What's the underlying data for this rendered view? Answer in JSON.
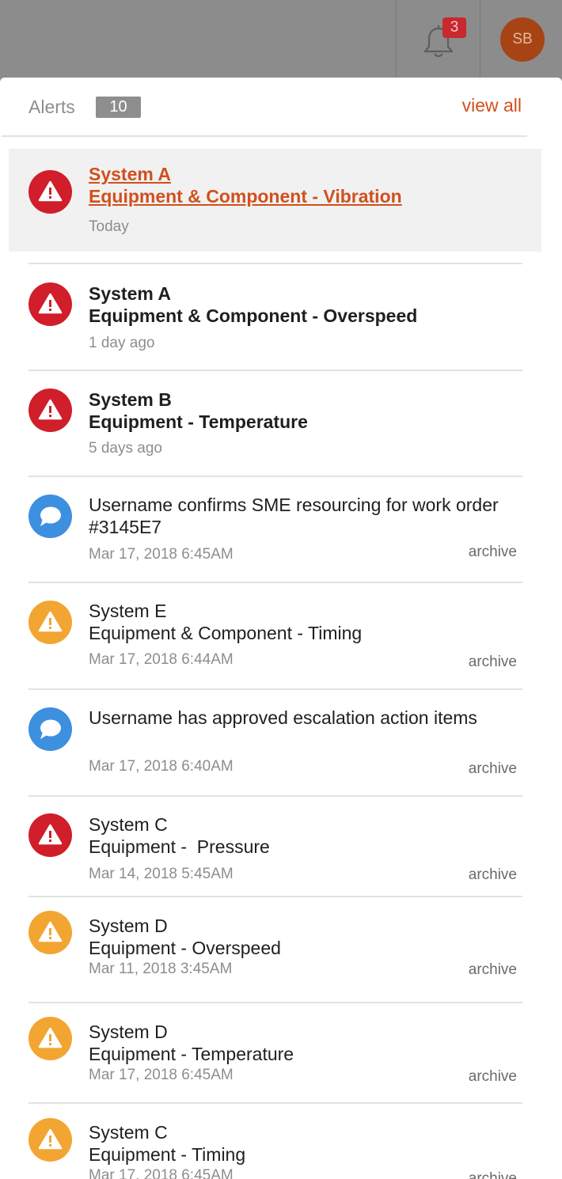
{
  "topbar": {
    "notification_count": "3",
    "avatar_initials": "SB",
    "bell_icon": "bell-icon"
  },
  "panel": {
    "title": "Alerts",
    "count": "10",
    "view_all": "view all",
    "colors": {
      "critical": "#d01e2b",
      "warning": "#f3a532",
      "message": "#3d8fe0",
      "accent": "#d1501c"
    },
    "items": [
      {
        "kind": "critical",
        "icon": "warning-triangle-icon",
        "title": "System A",
        "subtitle": "Equipment & Component - Vibration",
        "time": "Today"
      },
      {
        "kind": "critical",
        "icon": "warning-triangle-icon",
        "title": "System A",
        "subtitle": "Equipment & Component - Overspeed",
        "time": "1 day ago"
      },
      {
        "kind": "critical",
        "icon": "warning-triangle-icon",
        "title": "System B",
        "subtitle": "Equipment - Temperature",
        "time": "5 days ago"
      },
      {
        "kind": "message",
        "icon": "chat-bubble-icon",
        "message": "Username confirms SME resourcing for work order #3145E7",
        "time": "Mar 17, 2018 6:45AM",
        "archive": "archive"
      },
      {
        "kind": "warning",
        "icon": "warning-triangle-icon",
        "title": "System E",
        "subtitle": "Equipment & Component - Timing",
        "time": "Mar 17, 2018 6:44AM",
        "archive": "archive"
      },
      {
        "kind": "message",
        "icon": "chat-bubble-icon",
        "message": "Username has approved escalation action items",
        "time": "Mar 17, 2018 6:40AM",
        "archive": "archive"
      },
      {
        "kind": "critical",
        "icon": "warning-triangle-icon",
        "title": "System C",
        "subtitle": "Equipment -  Pressure",
        "time": "Mar 14, 2018 5:45AM",
        "archive": "archive"
      },
      {
        "kind": "warning",
        "icon": "warning-triangle-icon",
        "title": "System D",
        "subtitle": "Equipment - Overspeed",
        "time": "Mar 11, 2018 3:45AM",
        "archive": "archive"
      },
      {
        "kind": "warning",
        "icon": "warning-triangle-icon",
        "title": "System D",
        "subtitle": "Equipment - Temperature",
        "time": "Mar 17, 2018 6:45AM",
        "archive": "archive"
      },
      {
        "kind": "warning",
        "icon": "warning-triangle-icon",
        "title": "System C",
        "subtitle": "Equipment - Timing",
        "time": "Mar 17, 2018 6:45AM",
        "archive": "archive"
      }
    ]
  }
}
